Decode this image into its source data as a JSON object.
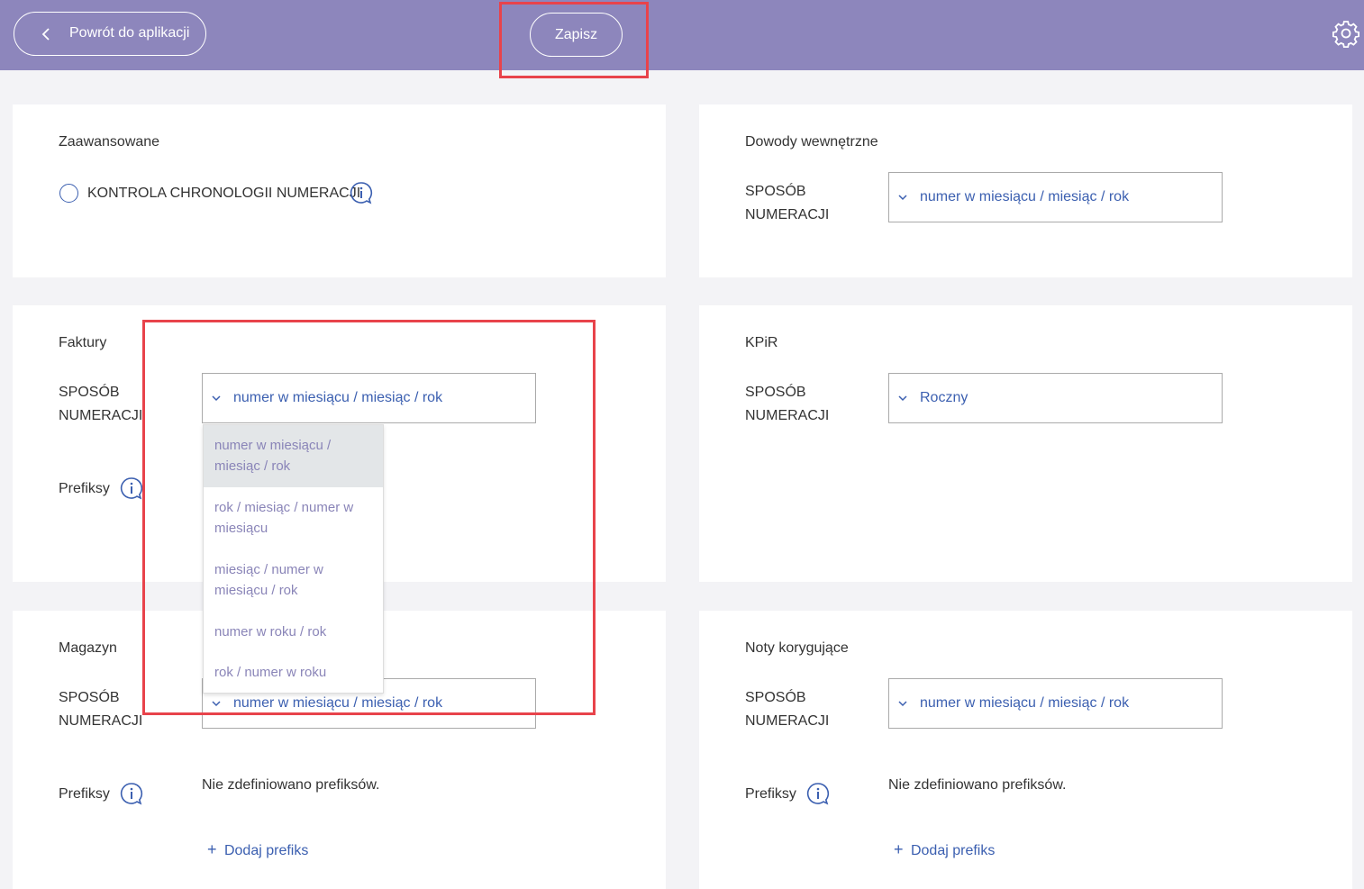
{
  "topbar": {
    "back_label": "Powrót do aplikacji",
    "save_label": "Zapisz",
    "bg_color": "#8d86bc"
  },
  "advanced": {
    "title": "Zaawansowane",
    "checkbox_label": "KONTROLA CHRONOLOGII NUMERACJI"
  },
  "internal": {
    "title": "Dowody wewnętrzne",
    "label_line1": "SPOSÓB",
    "label_line2": "NUMERACJI",
    "value": "numer w miesiącu / miesiąc / rok"
  },
  "invoices": {
    "title": "Faktury",
    "label_line1": "SPOSÓB",
    "label_line2": "NUMERACJI",
    "value": "numer w miesiącu / miesiąc / rok",
    "prefix_label": "Prefiksy",
    "options": [
      {
        "line1": "numer w miesiącu /",
        "line2": "miesiąc / rok"
      },
      {
        "line1": "rok / miesiąc / numer w",
        "line2": "miesiącu"
      },
      {
        "line1": "miesiąc / numer w",
        "line2": "miesiącu / rok"
      },
      {
        "line1": "numer w roku / rok",
        "line2": ""
      },
      {
        "line1": "rok / numer w roku",
        "line2": ""
      }
    ]
  },
  "kpir": {
    "title": "KPiR",
    "label_line1": "SPOSÓB",
    "label_line2": "NUMERACJI",
    "value": "Roczny"
  },
  "warehouse": {
    "title": "Magazyn",
    "label_line1": "SPOSÓB",
    "label_line2": "NUMERACJI",
    "value": "numer w miesiącu / miesiąc / rok",
    "prefix_label": "Prefiksy",
    "empty_text": "Nie zdefiniowano prefiksów.",
    "add_label": "Dodaj prefiks"
  },
  "corrective": {
    "title": "Noty korygujące",
    "label_line1": "SPOSÓB",
    "label_line2": "NUMERACJI",
    "value": "numer w miesiącu / miesiąc / rok",
    "prefix_label": "Prefiksy",
    "empty_text": "Nie zdefiniowano prefiksów.",
    "add_label": "Dodaj prefiks"
  },
  "colors": {
    "accent": "#3b5fb0",
    "highlight": "#e8434b",
    "option_text": "#8a85b8"
  }
}
